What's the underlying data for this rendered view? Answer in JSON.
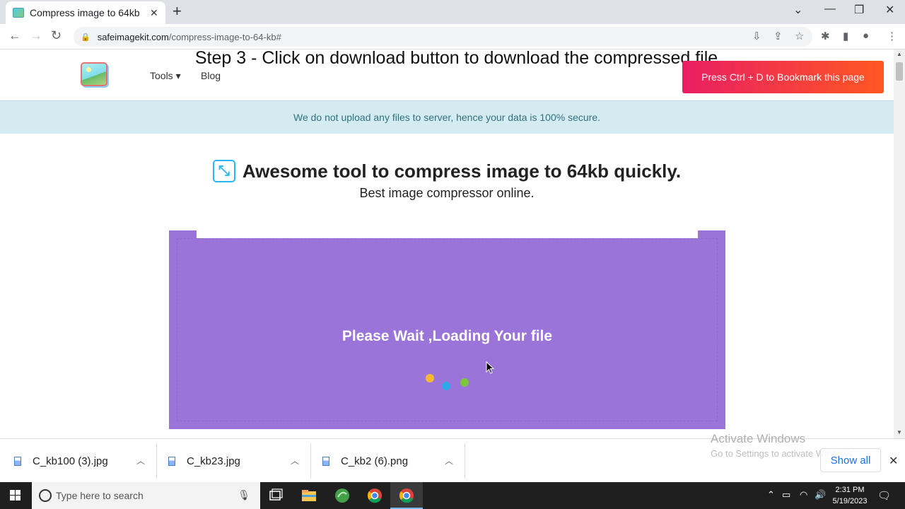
{
  "browser": {
    "tab_title": "Compress image to 64kb",
    "tab_close": "✕",
    "new_tab": "+",
    "url_host": "safeimagekit.com",
    "url_path": "/compress-image-to-64-kb#"
  },
  "site": {
    "nav": {
      "tools": "Tools ▾",
      "blog": "Blog"
    },
    "step_caption": "Step 3 - Click on download button to download the compressed file.",
    "bookmark_button": "Press Ctrl + D to Bookmark this page",
    "notice": "We do not upload any files to server, hence your data is 100% secure.",
    "headline": "Awesome tool to compress image to 64kb quickly.",
    "subheadline": "Best image compressor online.",
    "loading_text": "Please Wait ,Loading Your file",
    "loading_dot_colors": [
      "#f5b830",
      "#2fa8e8",
      "#7cc63a"
    ]
  },
  "downloads": {
    "items": [
      {
        "name": "C_kb100 (3).jpg"
      },
      {
        "name": "C_kb23.jpg"
      },
      {
        "name": "C_kb2 (6).png"
      }
    ],
    "show_all": "Show all"
  },
  "watermark": {
    "title": "Activate Windows",
    "subtitle": "Go to Settings to activate Windows."
  },
  "taskbar": {
    "search_placeholder": "Type here to search",
    "time": "2:31 PM",
    "date": "5/19/2023"
  }
}
